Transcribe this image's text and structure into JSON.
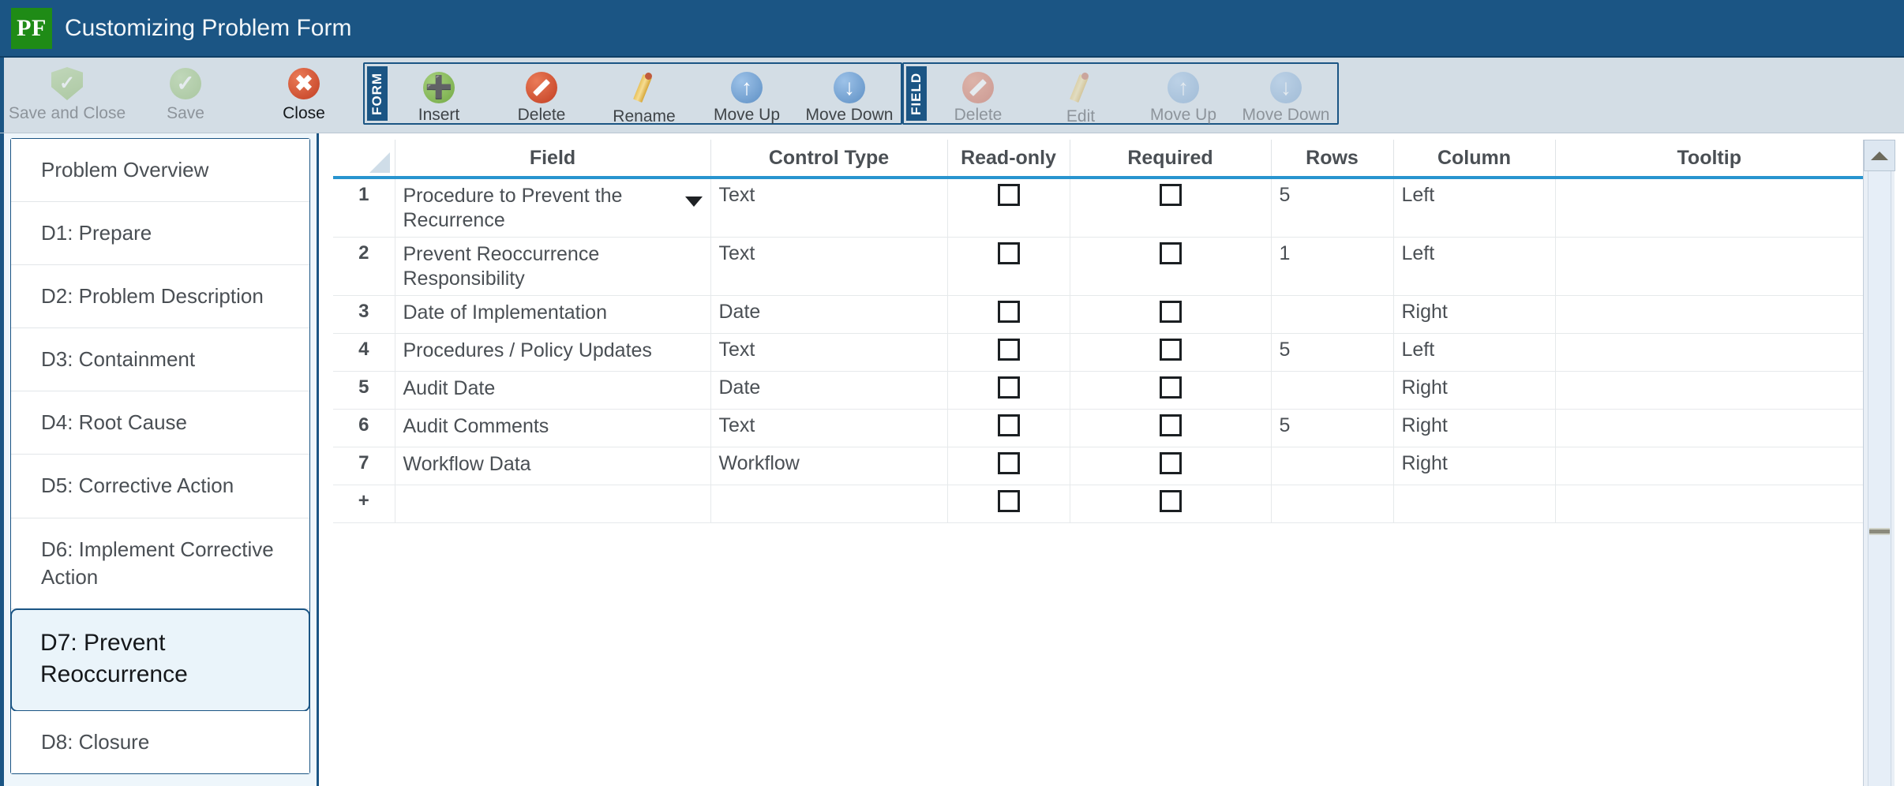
{
  "titlebar": {
    "logo_text": "PF",
    "title": "Customizing Problem Form"
  },
  "toolbar": {
    "standalone": [
      {
        "label": "Save and Close",
        "icon": "shield-check-icon",
        "state": "disabled"
      },
      {
        "label": "Save",
        "icon": "green-check-circle-icon",
        "state": "disabled"
      },
      {
        "label": "Close",
        "icon": "red-x-circle-icon",
        "state": "enabled"
      }
    ],
    "groups": [
      {
        "name": "FORM",
        "items": [
          {
            "label": "Insert",
            "icon": "green-plus-circle-icon",
            "state": "enabled"
          },
          {
            "label": "Delete",
            "icon": "red-block-circle-icon",
            "state": "enabled"
          },
          {
            "label": "Rename",
            "icon": "pencil-icon",
            "state": "enabled"
          },
          {
            "label": "Move Up",
            "icon": "blue-arrow-up-circle-icon",
            "state": "enabled"
          },
          {
            "label": "Move Down",
            "icon": "blue-arrow-down-circle-icon",
            "state": "enabled"
          }
        ]
      },
      {
        "name": "FIELD",
        "items": [
          {
            "label": "Delete",
            "icon": "red-block-circle-icon",
            "state": "disabled"
          },
          {
            "label": "Edit",
            "icon": "pencil-icon",
            "state": "disabled"
          },
          {
            "label": "Move Up",
            "icon": "blue-arrow-up-circle-icon",
            "state": "disabled"
          },
          {
            "label": "Move Down",
            "icon": "blue-arrow-down-circle-icon",
            "state": "disabled"
          }
        ]
      }
    ]
  },
  "sidebar": {
    "items": [
      {
        "label": "Problem Overview",
        "selected": false
      },
      {
        "label": "D1: Prepare",
        "selected": false
      },
      {
        "label": "D2: Problem Description",
        "selected": false
      },
      {
        "label": "D3: Containment",
        "selected": false
      },
      {
        "label": "D4: Root Cause",
        "selected": false
      },
      {
        "label": "D5: Corrective Action",
        "selected": false
      },
      {
        "label": "D6: Implement Corrective Action",
        "selected": false
      },
      {
        "label": "D7: Prevent Reoccurrence",
        "selected": true
      },
      {
        "label": "D8: Closure",
        "selected": false
      }
    ]
  },
  "grid": {
    "headers": [
      "",
      "Field",
      "Control Type",
      "Read-only",
      "Required",
      "Rows",
      "Column",
      "Tooltip"
    ],
    "rows": [
      {
        "index": "1",
        "field": "Procedure to Prevent the Recurrence",
        "has_dropdown": true,
        "control_type": "Text",
        "read_only": false,
        "required": false,
        "rows": "5",
        "rows_disabled": false,
        "required_disabled": false,
        "column": "Left",
        "tooltip": "",
        "tall": true
      },
      {
        "index": "2",
        "field": "Prevent Reoccurrence Responsibility",
        "has_dropdown": false,
        "control_type": "Text",
        "read_only": false,
        "required": false,
        "rows": "1",
        "rows_disabled": false,
        "required_disabled": false,
        "column": "Left",
        "tooltip": "",
        "tall": true
      },
      {
        "index": "3",
        "field": "Date of Implementation",
        "has_dropdown": false,
        "control_type": "Date",
        "read_only": false,
        "required": false,
        "rows": "",
        "rows_disabled": true,
        "required_disabled": false,
        "column": "Right",
        "tooltip": "",
        "tall": false
      },
      {
        "index": "4",
        "field": "Procedures / Policy Updates",
        "has_dropdown": false,
        "control_type": "Text",
        "read_only": false,
        "required": false,
        "rows": "5",
        "rows_disabled": false,
        "required_disabled": false,
        "column": "Left",
        "tooltip": "",
        "tall": false
      },
      {
        "index": "5",
        "field": "Audit Date",
        "has_dropdown": false,
        "control_type": "Date",
        "read_only": false,
        "required": false,
        "rows": "",
        "rows_disabled": true,
        "required_disabled": false,
        "column": "Right",
        "tooltip": "",
        "tall": false
      },
      {
        "index": "6",
        "field": "Audit Comments",
        "has_dropdown": false,
        "control_type": "Text",
        "read_only": false,
        "required": false,
        "rows": "5",
        "rows_disabled": false,
        "required_disabled": false,
        "column": "Right",
        "tooltip": "",
        "tall": false
      },
      {
        "index": "7",
        "field": "Workflow Data",
        "has_dropdown": false,
        "control_type": "Workflow",
        "read_only": false,
        "required": false,
        "rows": "",
        "rows_disabled": true,
        "required_disabled": true,
        "column": "Right",
        "tooltip": "",
        "tall": false
      },
      {
        "index": "+",
        "field": "",
        "has_dropdown": false,
        "control_type": "",
        "read_only": false,
        "required": false,
        "rows": "",
        "rows_disabled": true,
        "required_disabled": false,
        "column": "",
        "tooltip": "",
        "tall": false,
        "is_add_row": true
      }
    ]
  },
  "scrollbar": {
    "up_arrow_icon": "triangle-up-icon",
    "grip_icon": "scroll-grip-icon"
  },
  "colors": {
    "title_bar": "#1b5584",
    "logo_green": "#1f8b16",
    "ribbon_bg": "#d3dde5",
    "accent_underline": "#2894cf",
    "selection_bg": "#eaf4fa",
    "disabled_cell": "#efefef"
  }
}
